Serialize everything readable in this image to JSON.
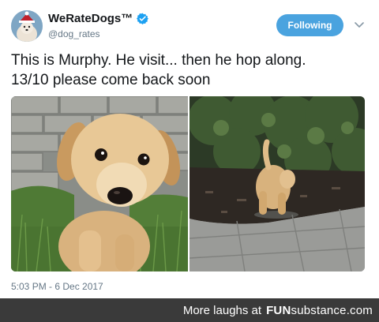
{
  "header": {
    "display_name": "WeRateDogs™",
    "handle": "@dog_rates",
    "follow_label": "Following"
  },
  "tweet": {
    "text_line1": "This is Murphy. He visit... then he hop along.",
    "text_line2": "13/10 please come back soon",
    "timestamp": "5:03 PM - 6 Dec 2017"
  },
  "colors": {
    "follow_button": "#4aa3df",
    "verified_badge": "#1da1f2",
    "footer_bg": "#3a3a3a"
  },
  "icons": {
    "verified": "verified-badge-icon",
    "menu": "chevron-down-icon"
  },
  "footer": {
    "more_label": "More laughs at",
    "brand_part1": "FUN",
    "brand_part2": "substance",
    "brand_part3": ".com"
  }
}
